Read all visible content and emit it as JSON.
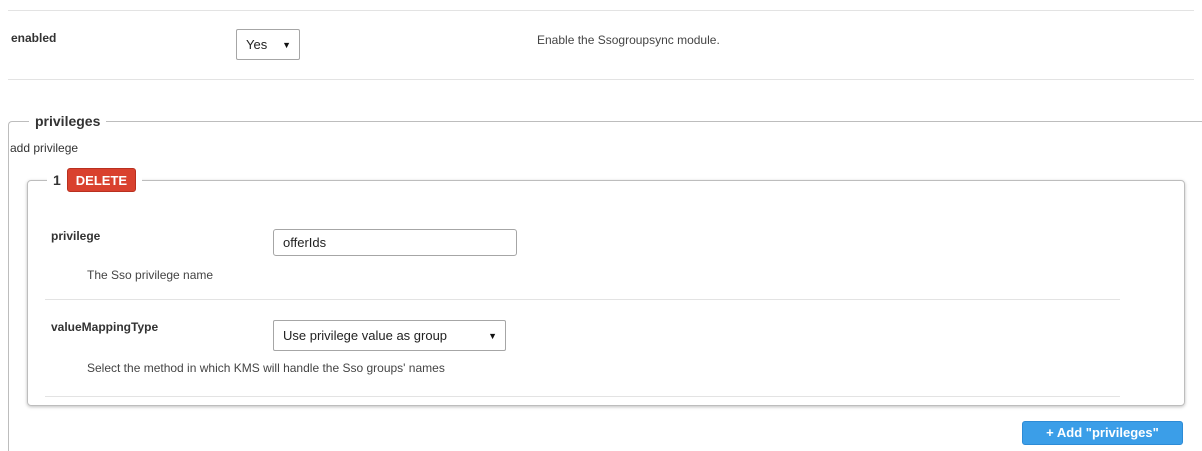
{
  "enabled": {
    "label": "enabled",
    "value": "Yes",
    "description": "Enable the Ssogroupsync module."
  },
  "privileges": {
    "legend": "privileges",
    "add_text": "add privilege",
    "items": [
      {
        "index": "1",
        "delete_label": "DELETE",
        "privilege": {
          "label": "privilege",
          "value": "offerIds",
          "description": "The Sso privilege name"
        },
        "valueMappingType": {
          "label": "valueMappingType",
          "value": "Use privilege value as group",
          "description": "Select the method in which KMS will handle the Sso groups' names"
        }
      }
    ],
    "add_button_label": "+ Add \"privileges\""
  },
  "icons": {
    "caret": "▼"
  }
}
